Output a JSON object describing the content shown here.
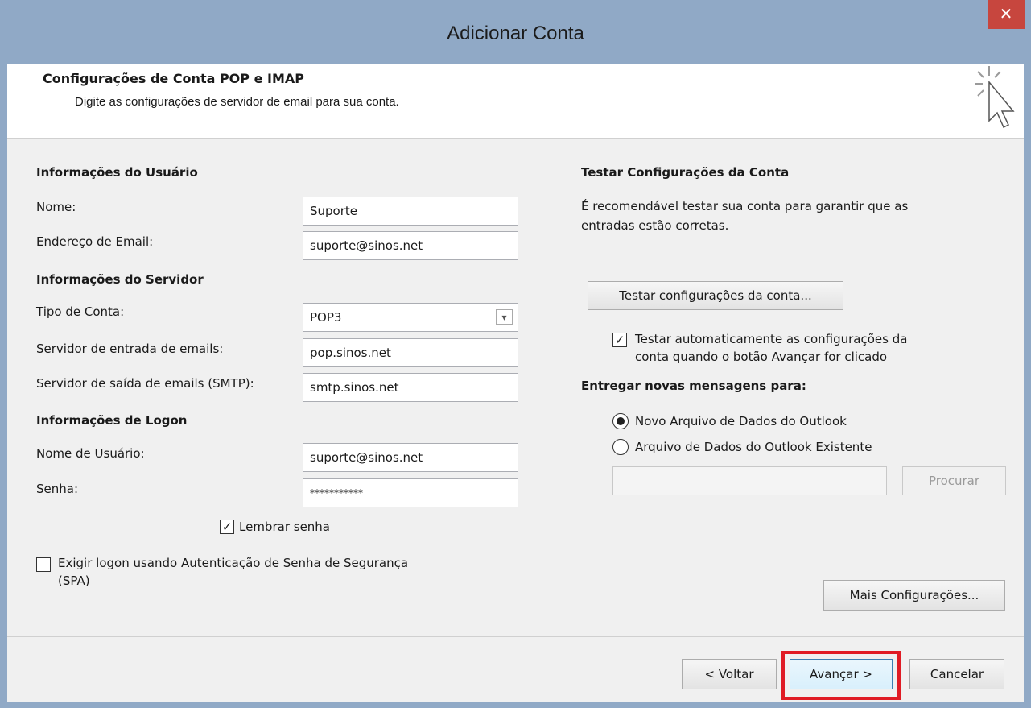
{
  "window": {
    "title": "Adicionar Conta",
    "close_glyph": "✕"
  },
  "header": {
    "title": "Configurações de Conta POP e IMAP",
    "subtitle": "Digite as configurações de servidor de email para sua conta.",
    "icon": "cursor-click-icon"
  },
  "user_info": {
    "section_title": "Informações do Usuário",
    "name_label": "Nome:",
    "name_value": "Suporte",
    "email_label": "Endereço de Email:",
    "email_value": "suporte@sinos.net"
  },
  "server_info": {
    "section_title": "Informações do Servidor",
    "account_type_label": "Tipo de Conta:",
    "account_type_value": "POP3",
    "incoming_label": "Servidor de entrada de emails:",
    "incoming_value": "pop.sinos.net",
    "outgoing_label": "Servidor de saída de emails (SMTP):",
    "outgoing_value": "smtp.sinos.net"
  },
  "logon_info": {
    "section_title": "Informações de Logon",
    "username_label": "Nome de Usuário:",
    "username_value": "suporte@sinos.net",
    "password_label": "Senha:",
    "password_value": "***********",
    "remember_label": "Lembrar senha",
    "remember_checked": true,
    "spa_label_line1": "Exigir logon usando Autenticação de Senha de Segurança",
    "spa_label_line2": "(SPA)",
    "spa_checked": false
  },
  "test_settings": {
    "section_title": "Testar Configurações da Conta",
    "description_line1": "É recomendável testar sua conta para garantir que as",
    "description_line2": "entradas estão corretas.",
    "test_button": "Testar configurações da conta...",
    "auto_test_line1": "Testar automaticamente as configurações da",
    "auto_test_line2": "conta quando o botão Avançar for clicado",
    "auto_test_checked": true
  },
  "delivery": {
    "section_title": "Entregar novas mensagens para:",
    "option_new": "Novo Arquivo de Dados do Outlook",
    "option_existing": "Arquivo de Dados do Outlook Existente",
    "selected": "new",
    "path_value": "",
    "browse_button": "Procurar"
  },
  "more_settings_button": "Mais Configurações...",
  "footer": {
    "back_button": "< Voltar",
    "next_button": "Avançar >",
    "cancel_button": "Cancelar"
  },
  "colors": {
    "titlebar": "#90a9c6",
    "close": "#c7463e",
    "highlight": "#e01b24"
  }
}
